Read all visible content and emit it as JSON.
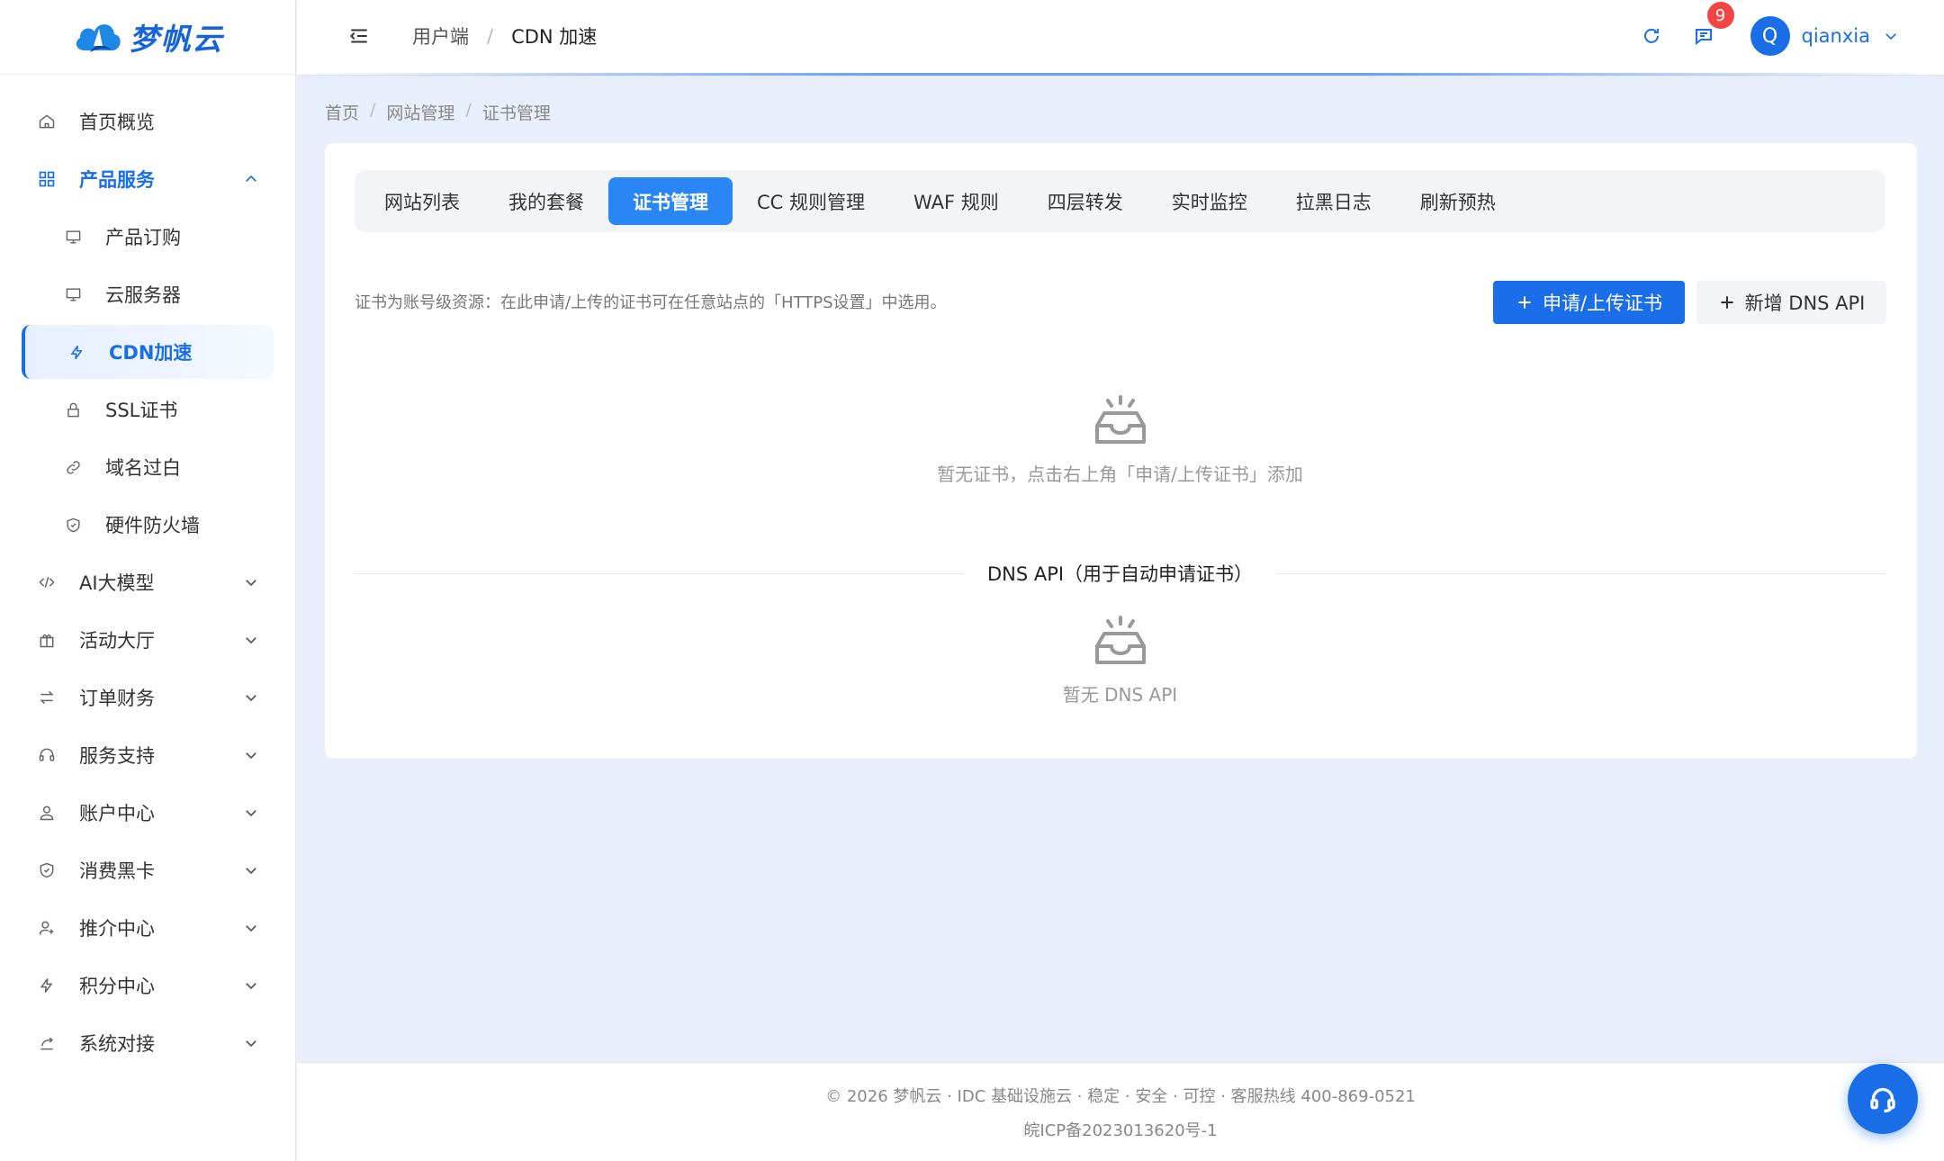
{
  "brand": {
    "name": "梦帆云",
    "accent": "#1a6ee8"
  },
  "sidebar": {
    "items": [
      {
        "label": "首页概览",
        "icon": "home-icon"
      },
      {
        "label": "产品服务",
        "icon": "grid-icon",
        "expanded": true,
        "children": [
          {
            "label": "产品订购",
            "icon": "monitor-icon"
          },
          {
            "label": "云服务器",
            "icon": "monitor-icon"
          },
          {
            "label": "CDN加速",
            "icon": "lightning-icon",
            "active": true
          },
          {
            "label": "SSL证书",
            "icon": "lock-icon"
          },
          {
            "label": "域名过白",
            "icon": "link-icon"
          },
          {
            "label": "硬件防火墙",
            "icon": "shield-icon"
          }
        ]
      },
      {
        "label": "AI大模型",
        "icon": "code-icon"
      },
      {
        "label": "活动大厅",
        "icon": "gift-icon"
      },
      {
        "label": "订单财务",
        "icon": "swap-icon"
      },
      {
        "label": "服务支持",
        "icon": "headset-icon"
      },
      {
        "label": "账户中心",
        "icon": "user-icon"
      },
      {
        "label": "消费黑卡",
        "icon": "shield-check-icon"
      },
      {
        "label": "推介中心",
        "icon": "user-add-icon"
      },
      {
        "label": "积分中心",
        "icon": "lightning-icon"
      },
      {
        "label": "系统对接",
        "icon": "share-icon"
      }
    ]
  },
  "header": {
    "crumb_root": "用户端",
    "crumb_sep": "/",
    "crumb_current": "CDN 加速",
    "notification_count": "9",
    "avatar_letter": "Q",
    "username": "qianxia"
  },
  "breadcrumb": {
    "items": [
      "首页",
      "网站管理",
      "证书管理"
    ],
    "sep": "/"
  },
  "tabs": [
    {
      "label": "网站列表"
    },
    {
      "label": "我的套餐"
    },
    {
      "label": "证书管理",
      "active": true
    },
    {
      "label": "CC 规则管理"
    },
    {
      "label": "WAF 规则"
    },
    {
      "label": "四层转发"
    },
    {
      "label": "实时监控"
    },
    {
      "label": "拉黑日志"
    },
    {
      "label": "刷新预热"
    }
  ],
  "cert": {
    "info": "证书为账号级资源：在此申请/上传的证书可在任意站点的「HTTPS设置」中选用。",
    "apply_button": "申请/上传证书",
    "add_dns_button": "新增 DNS API",
    "empty_text": "暂无证书，点击右上角「申请/上传证书」添加",
    "dns_divider": "DNS API（用于自动申请证书）",
    "dns_empty_text": "暂无 DNS API"
  },
  "footer": {
    "line1": "© 2026 梦帆云 · IDC 基础设施云 · 稳定 · 安全 · 可控 · 客服热线 400-869-0521",
    "line2": "皖ICP备2023013620号-1"
  }
}
